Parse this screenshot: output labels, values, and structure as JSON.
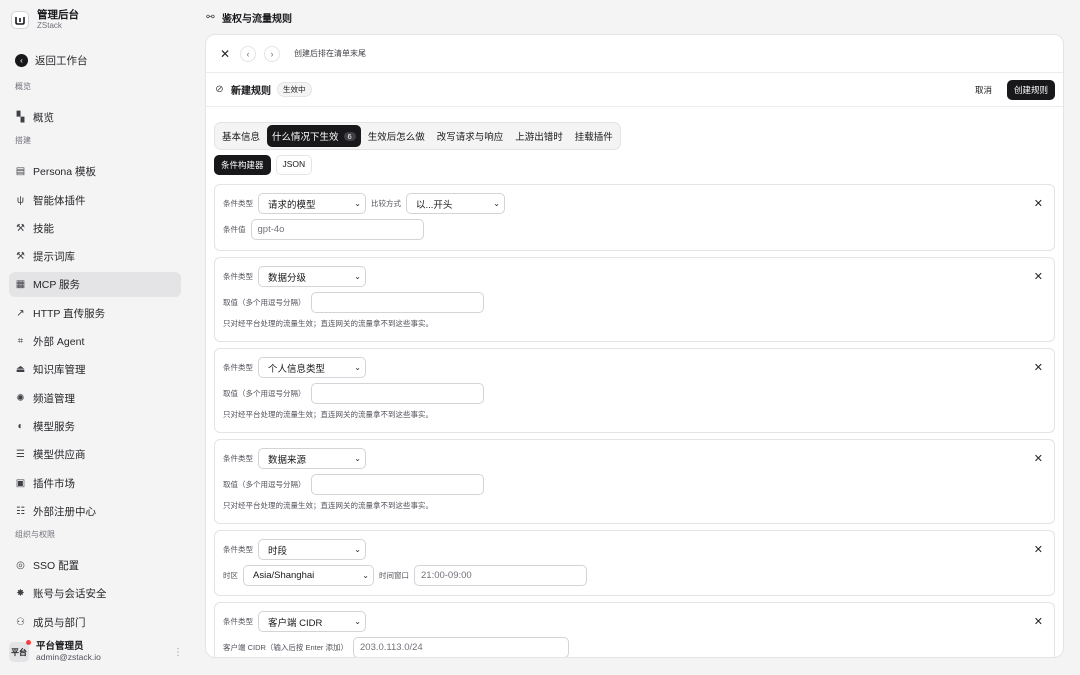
{
  "brand": {
    "title": "管理后台",
    "subtitle": "ZStack"
  },
  "nav": {
    "back": "返回工作台",
    "section_overview": "概览",
    "overview": "概览",
    "section_build": "搭建",
    "build_items": [
      "Persona 模板",
      "智能体插件",
      "技能",
      "提示词库",
      "MCP 服务",
      "HTTP 直传服务",
      "外部 Agent",
      "知识库管理",
      "频道管理",
      "模型服务",
      "模型供应商",
      "插件市场",
      "外部注册中心"
    ],
    "section_org": "组织与权限",
    "org_items": [
      "SSO 配置",
      "账号与会话安全",
      "成员与部门"
    ]
  },
  "user": {
    "avatar": "平台",
    "name": "平台管理员",
    "email": "admin@zstack.io"
  },
  "topbar": {
    "title": "鉴权与流量规则"
  },
  "panel": {
    "hint": "创建后排在清单末尾"
  },
  "rule": {
    "title": "新建规则",
    "badge": "生效中",
    "cancel": "取消",
    "create": "创建规则"
  },
  "tabs": [
    "基本信息",
    "什么情况下生效",
    "生效后怎么做",
    "改写请求与响应",
    "上游出错时",
    "挂载插件"
  ],
  "tab_count": "6",
  "subtabs": [
    "条件构建器",
    "JSON"
  ],
  "labels": {
    "cond_type": "条件类型",
    "compare": "比较方式",
    "cond_value": "条件值",
    "multi_value": "取值（多个用逗号分隔）",
    "note": "只对经平台处理的流量生效；直连网关的流量拿不到这些事实。",
    "timezone": "时区",
    "time_window": "时间窗口",
    "cidr": "客户端 CIDR（输入后按 Enter 添加）"
  },
  "conditions": [
    {
      "type": "请求的模型",
      "compare": "以...开头",
      "value_placeholder": "gpt-4o"
    },
    {
      "type": "数据分级"
    },
    {
      "type": "个人信息类型"
    },
    {
      "type": "数据来源"
    },
    {
      "type": "时段",
      "timezone": "Asia/Shanghai",
      "window_placeholder": "21:00-09:00"
    },
    {
      "type": "客户端 CIDR",
      "cidr_placeholder": "203.0.113.0/24"
    }
  ]
}
